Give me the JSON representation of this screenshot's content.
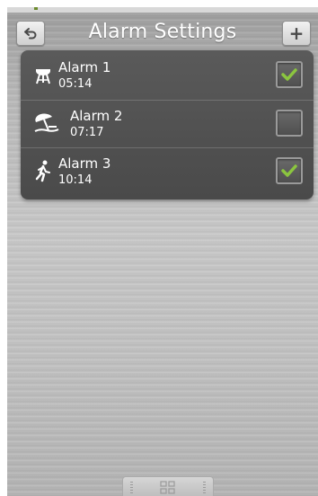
{
  "header": {
    "title": "Alarm Settings",
    "back_icon": "back-arrow-icon",
    "add_label": "+"
  },
  "alarms": [
    {
      "name": "Alarm 1",
      "time": "05:14",
      "icon": "grill-icon",
      "enabled": true
    },
    {
      "name": "Alarm 2",
      "time": "07:17",
      "icon": "beach-umbrella-icon",
      "enabled": false
    },
    {
      "name": "Alarm 3",
      "time": "10:14",
      "icon": "walking-person-icon",
      "enabled": true
    }
  ],
  "bottom_bar": {
    "icon": "app-grid-icon"
  },
  "colors": {
    "check": "#8bc53f",
    "list_bg": "#505050",
    "text": "#ffffff"
  }
}
